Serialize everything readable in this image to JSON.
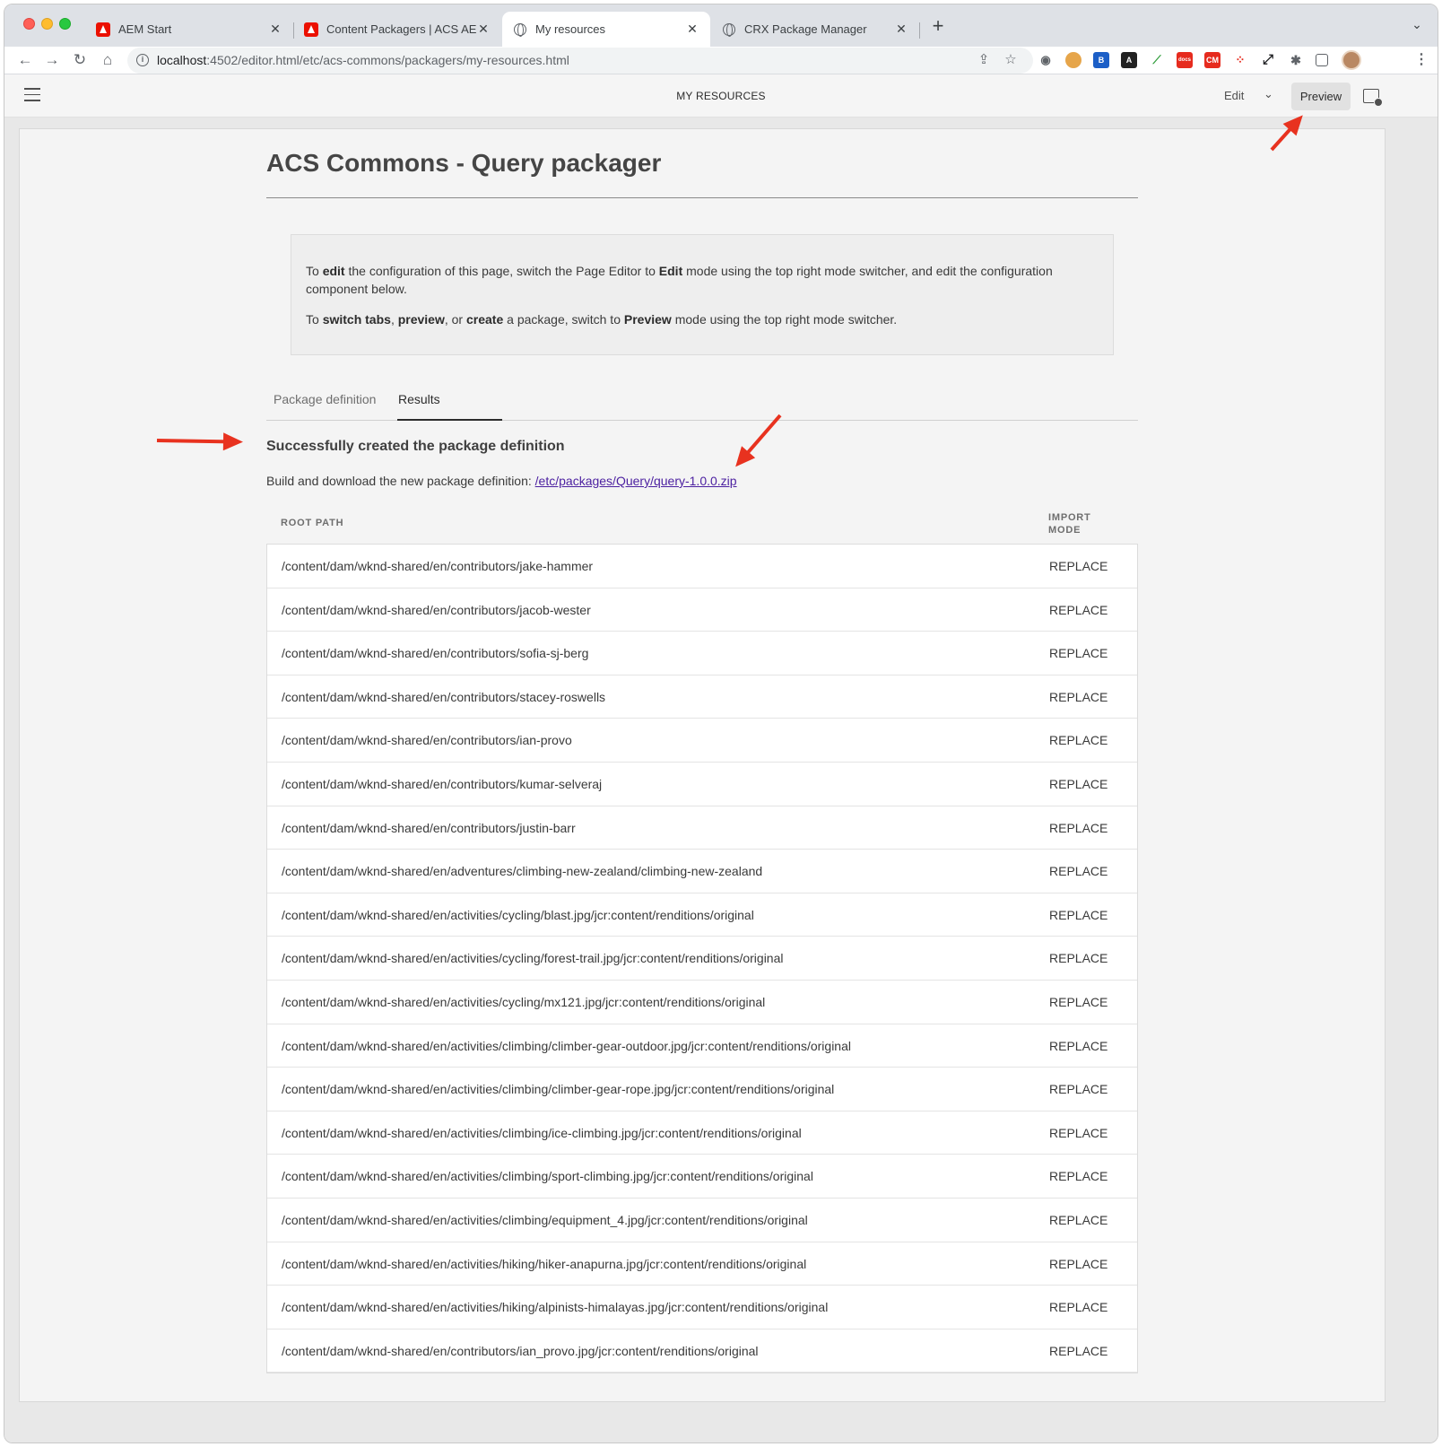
{
  "browser": {
    "tabs": [
      {
        "title": "AEM Start",
        "favicon": "adobe-icon"
      },
      {
        "title": "Content Packagers | ACS AEM",
        "favicon": "adobe-icon"
      },
      {
        "title": "My resources",
        "favicon": "globe-icon"
      },
      {
        "title": "CRX Package Manager",
        "favicon": "globe-icon"
      }
    ],
    "active_tab": 2,
    "url_host": "localhost",
    "url_rest": ":4502/editor.html/etc/acs-commons/packagers/my-resources.html"
  },
  "editor": {
    "title": "MY RESOURCES",
    "mode_edit_label": "Edit",
    "mode_preview_label": "Preview"
  },
  "page": {
    "title": "ACS Commons - Query packager",
    "info": {
      "line1_a": "To ",
      "line1_b": "edit",
      "line1_c": " the configuration of this page, switch the Page Editor to ",
      "line1_d": "Edit",
      "line1_e": " mode using the top right mode switcher, and edit the configuration component below.",
      "line2_a": "To ",
      "line2_b": "switch tabs",
      "line2_c": ", ",
      "line2_d": "preview",
      "line2_e": ", or ",
      "line2_f": "create",
      "line2_g": " a package, switch to ",
      "line2_h": "Preview",
      "line2_i": " mode using the top right mode switcher."
    },
    "tabs": [
      "Package definition",
      "Results"
    ],
    "active_tab": 1,
    "success_heading": "Successfully created the package definition",
    "build_text": "Build and download the new package definition: ",
    "build_link": "/etc/packages/Query/query-1.0.0.zip",
    "table": {
      "col_root": "ROOT PATH",
      "col_mode_1": "IMPORT",
      "col_mode_2": "MODE",
      "rows": [
        {
          "path": "/content/dam/wknd-shared/en/contributors/jake-hammer",
          "mode": "REPLACE"
        },
        {
          "path": "/content/dam/wknd-shared/en/contributors/jacob-wester",
          "mode": "REPLACE"
        },
        {
          "path": "/content/dam/wknd-shared/en/contributors/sofia-sj-berg",
          "mode": "REPLACE"
        },
        {
          "path": "/content/dam/wknd-shared/en/contributors/stacey-roswells",
          "mode": "REPLACE"
        },
        {
          "path": "/content/dam/wknd-shared/en/contributors/ian-provo",
          "mode": "REPLACE"
        },
        {
          "path": "/content/dam/wknd-shared/en/contributors/kumar-selveraj",
          "mode": "REPLACE"
        },
        {
          "path": "/content/dam/wknd-shared/en/contributors/justin-barr",
          "mode": "REPLACE"
        },
        {
          "path": "/content/dam/wknd-shared/en/adventures/climbing-new-zealand/climbing-new-zealand",
          "mode": "REPLACE"
        },
        {
          "path": "/content/dam/wknd-shared/en/activities/cycling/blast.jpg/jcr:content/renditions/original",
          "mode": "REPLACE"
        },
        {
          "path": "/content/dam/wknd-shared/en/activities/cycling/forest-trail.jpg/jcr:content/renditions/original",
          "mode": "REPLACE"
        },
        {
          "path": "/content/dam/wknd-shared/en/activities/cycling/mx121.jpg/jcr:content/renditions/original",
          "mode": "REPLACE"
        },
        {
          "path": "/content/dam/wknd-shared/en/activities/climbing/climber-gear-outdoor.jpg/jcr:content/renditions/original",
          "mode": "REPLACE"
        },
        {
          "path": "/content/dam/wknd-shared/en/activities/climbing/climber-gear-rope.jpg/jcr:content/renditions/original",
          "mode": "REPLACE"
        },
        {
          "path": "/content/dam/wknd-shared/en/activities/climbing/ice-climbing.jpg/jcr:content/renditions/original",
          "mode": "REPLACE"
        },
        {
          "path": "/content/dam/wknd-shared/en/activities/climbing/sport-climbing.jpg/jcr:content/renditions/original",
          "mode": "REPLACE"
        },
        {
          "path": "/content/dam/wknd-shared/en/activities/climbing/equipment_4.jpg/jcr:content/renditions/original",
          "mode": "REPLACE"
        },
        {
          "path": "/content/dam/wknd-shared/en/activities/hiking/hiker-anapurna.jpg/jcr:content/renditions/original",
          "mode": "REPLACE"
        },
        {
          "path": "/content/dam/wknd-shared/en/activities/hiking/alpinists-himalayas.jpg/jcr:content/renditions/original",
          "mode": "REPLACE"
        },
        {
          "path": "/content/dam/wknd-shared/en/contributors/ian_provo.jpg/jcr:content/renditions/original",
          "mode": "REPLACE"
        }
      ]
    }
  },
  "colors": {
    "annotation_arrow": "#e8321f",
    "link": "#4b1fa0"
  }
}
